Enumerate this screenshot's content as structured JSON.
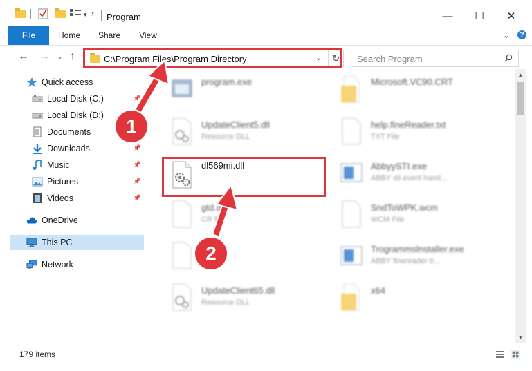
{
  "window": {
    "title": "Program",
    "minimize": "—",
    "maximize": "☐",
    "close": "✕"
  },
  "ribbon": {
    "tabs": [
      {
        "label": "File"
      },
      {
        "label": "Home"
      },
      {
        "label": "Share"
      },
      {
        "label": "View"
      }
    ],
    "expand_glyph": "⌄",
    "help_glyph": "?"
  },
  "address": {
    "path": "C:\\Program Files\\Program Directory",
    "dropdown_glyph": "⌄",
    "refresh_glyph": "↻"
  },
  "search": {
    "placeholder": "Search Program"
  },
  "nav": {
    "back": "←",
    "forward": "→",
    "recent": "⌄",
    "up": "↑"
  },
  "sidebar": {
    "items": [
      {
        "label": "Quick access",
        "icon": "star-icon"
      },
      {
        "label": "Local Disk (C:)",
        "icon": "drive-icon"
      },
      {
        "label": "Local Disk (D:)",
        "icon": "drive-icon"
      },
      {
        "label": "Documents",
        "icon": "documents-icon"
      },
      {
        "label": "Downloads",
        "icon": "downloads-icon"
      },
      {
        "label": "Music",
        "icon": "music-icon"
      },
      {
        "label": "Pictures",
        "icon": "pictures-icon"
      },
      {
        "label": "Videos",
        "icon": "videos-icon"
      },
      {
        "label": "OneDrive",
        "icon": "cloud-icon"
      },
      {
        "label": "This PC",
        "icon": "computer-icon"
      },
      {
        "label": "Network",
        "icon": "network-icon"
      }
    ]
  },
  "files": [
    {
      "name": "program.exe",
      "sub": ""
    },
    {
      "name": "Microsoft.VC90.CRT",
      "sub": ""
    },
    {
      "name": "UpdateClient5.dll",
      "sub": "Resource DLL"
    },
    {
      "name": "help.fineReader.txt",
      "sub": "TXT File"
    },
    {
      "name": "dl569mi.dll",
      "sub": ""
    },
    {
      "name": "AbbyySTI.exe",
      "sub": "ABBY sti event hand..."
    },
    {
      "name": "gtd.dll",
      "sub": "CR file"
    },
    {
      "name": "SndToWPK.wcm",
      "sub": "WCM File"
    },
    {
      "name": "Trogrammslnstaller.exe",
      "sub": "ABBY finereader tr..."
    },
    {
      "name": "UpdateClient65.dll",
      "sub": "Resource DLL"
    },
    {
      "name": "x64",
      "sub": ""
    }
  ],
  "status": {
    "item_count": "179 items"
  },
  "annotations": {
    "step1": "1",
    "step2": "2"
  },
  "colors": {
    "accent": "#1979ca",
    "highlight": "#e0353b",
    "selected": "#cce4f7",
    "folder": "#f4c84b"
  }
}
